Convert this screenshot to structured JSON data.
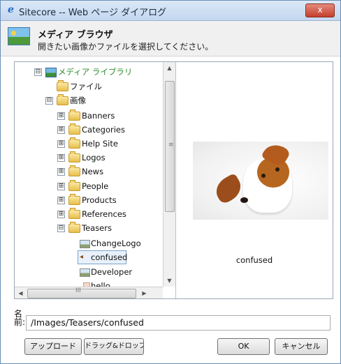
{
  "window": {
    "title": "Sitecore -- Web ページ ダイアログ",
    "close_label": "x"
  },
  "header": {
    "title": "メディア ブラウザ",
    "description": "開きたい画像かファイルを選択してください。"
  },
  "tree": {
    "root_label": "メディア ライブラリ",
    "items": [
      {
        "label": "ファイル"
      },
      {
        "label": "画像"
      },
      {
        "label": "Banners"
      },
      {
        "label": "Categories"
      },
      {
        "label": "Help Site"
      },
      {
        "label": "Logos"
      },
      {
        "label": "News"
      },
      {
        "label": "People"
      },
      {
        "label": "Products"
      },
      {
        "label": "References"
      },
      {
        "label": "Teasers"
      },
      {
        "label": "ChangeLogo"
      },
      {
        "label": "confused"
      },
      {
        "label": "Developer"
      },
      {
        "label": "hello"
      }
    ],
    "collapse_glyph": "⊟",
    "expand_glyph": "⊞"
  },
  "scrollbars": {
    "up": "▲",
    "down": "▼",
    "left": "◀",
    "right": "▶",
    "vgrip": "≡",
    "hgrip": "III"
  },
  "preview": {
    "caption": "confused"
  },
  "name_field": {
    "label": "名前:",
    "value": "/Images/Teasers/confused"
  },
  "buttons": {
    "upload": "アップロード",
    "drag_drop": "ドラッグ&ドロップ",
    "ok": "OK",
    "cancel": "キャンセル"
  },
  "colors": {
    "root_text": "#2a8a2a",
    "close_button": "#c3402b"
  },
  "icons": {
    "title": "ie-icon",
    "header": "media-library-icon",
    "folder": "folder-icon",
    "image": "image-thumbnail-icon"
  }
}
